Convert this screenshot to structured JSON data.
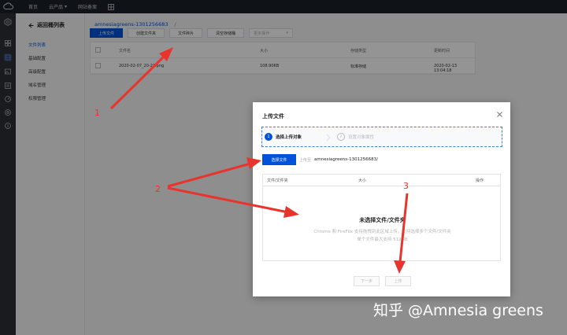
{
  "topbar": {
    "nav_home": "首页",
    "nav_products": "云产品",
    "nav_filing": "网站备案"
  },
  "sidebar": {
    "back_label": "返回桶列表",
    "items": [
      {
        "label": "文件列表"
      },
      {
        "label": "基础配置"
      },
      {
        "label": "高级配置"
      },
      {
        "label": "域名管理"
      },
      {
        "label": "权限管理"
      }
    ]
  },
  "main": {
    "breadcrumb": "amnesiagreens-1301256683",
    "breadcrumb_sep": "/",
    "toolbar": {
      "upload": "上传文件",
      "create_folder": "创建文件夹",
      "fragments": "文件碎片",
      "clear_bucket": "清空存储桶",
      "more": "更多操作"
    },
    "table": {
      "headers": [
        "文件名",
        "大小",
        "存储类型",
        "更新时间"
      ],
      "rows": [
        {
          "name": "2020-02-07_20-21.png",
          "size": "108.90KB",
          "storage": "标准存储",
          "updated": "2020-02-13 13:04:18"
        }
      ]
    }
  },
  "modal": {
    "title": "上传文件",
    "steps": [
      {
        "num": "1",
        "label": "选择上传对象"
      },
      {
        "num": "2",
        "label": "设置对象属性"
      }
    ],
    "select_button": "选择文件",
    "upload_to_label": "上传至",
    "upload_path": "amnesiagreens-1301256683/",
    "file_table_headers": [
      "文件/文件夹",
      "大小",
      "操作"
    ],
    "empty_title": "未选择文件/文件夹",
    "empty_desc_1": "Chrome 和 FireFox 支持拖拽到此区域上传，支持选择多个文件/文件夹",
    "empty_desc_2": "单个文件最大支持 512GB",
    "prev_button": "下一步",
    "upload_button": "上传"
  },
  "annotations": {
    "label_1": "1",
    "label_2": "2",
    "label_3": "3",
    "color": "#e8342c"
  },
  "watermark": "知乎 @Amnesia greens",
  "colors": {
    "primary": "#0052d9",
    "nav_bg": "#1b1f26"
  }
}
